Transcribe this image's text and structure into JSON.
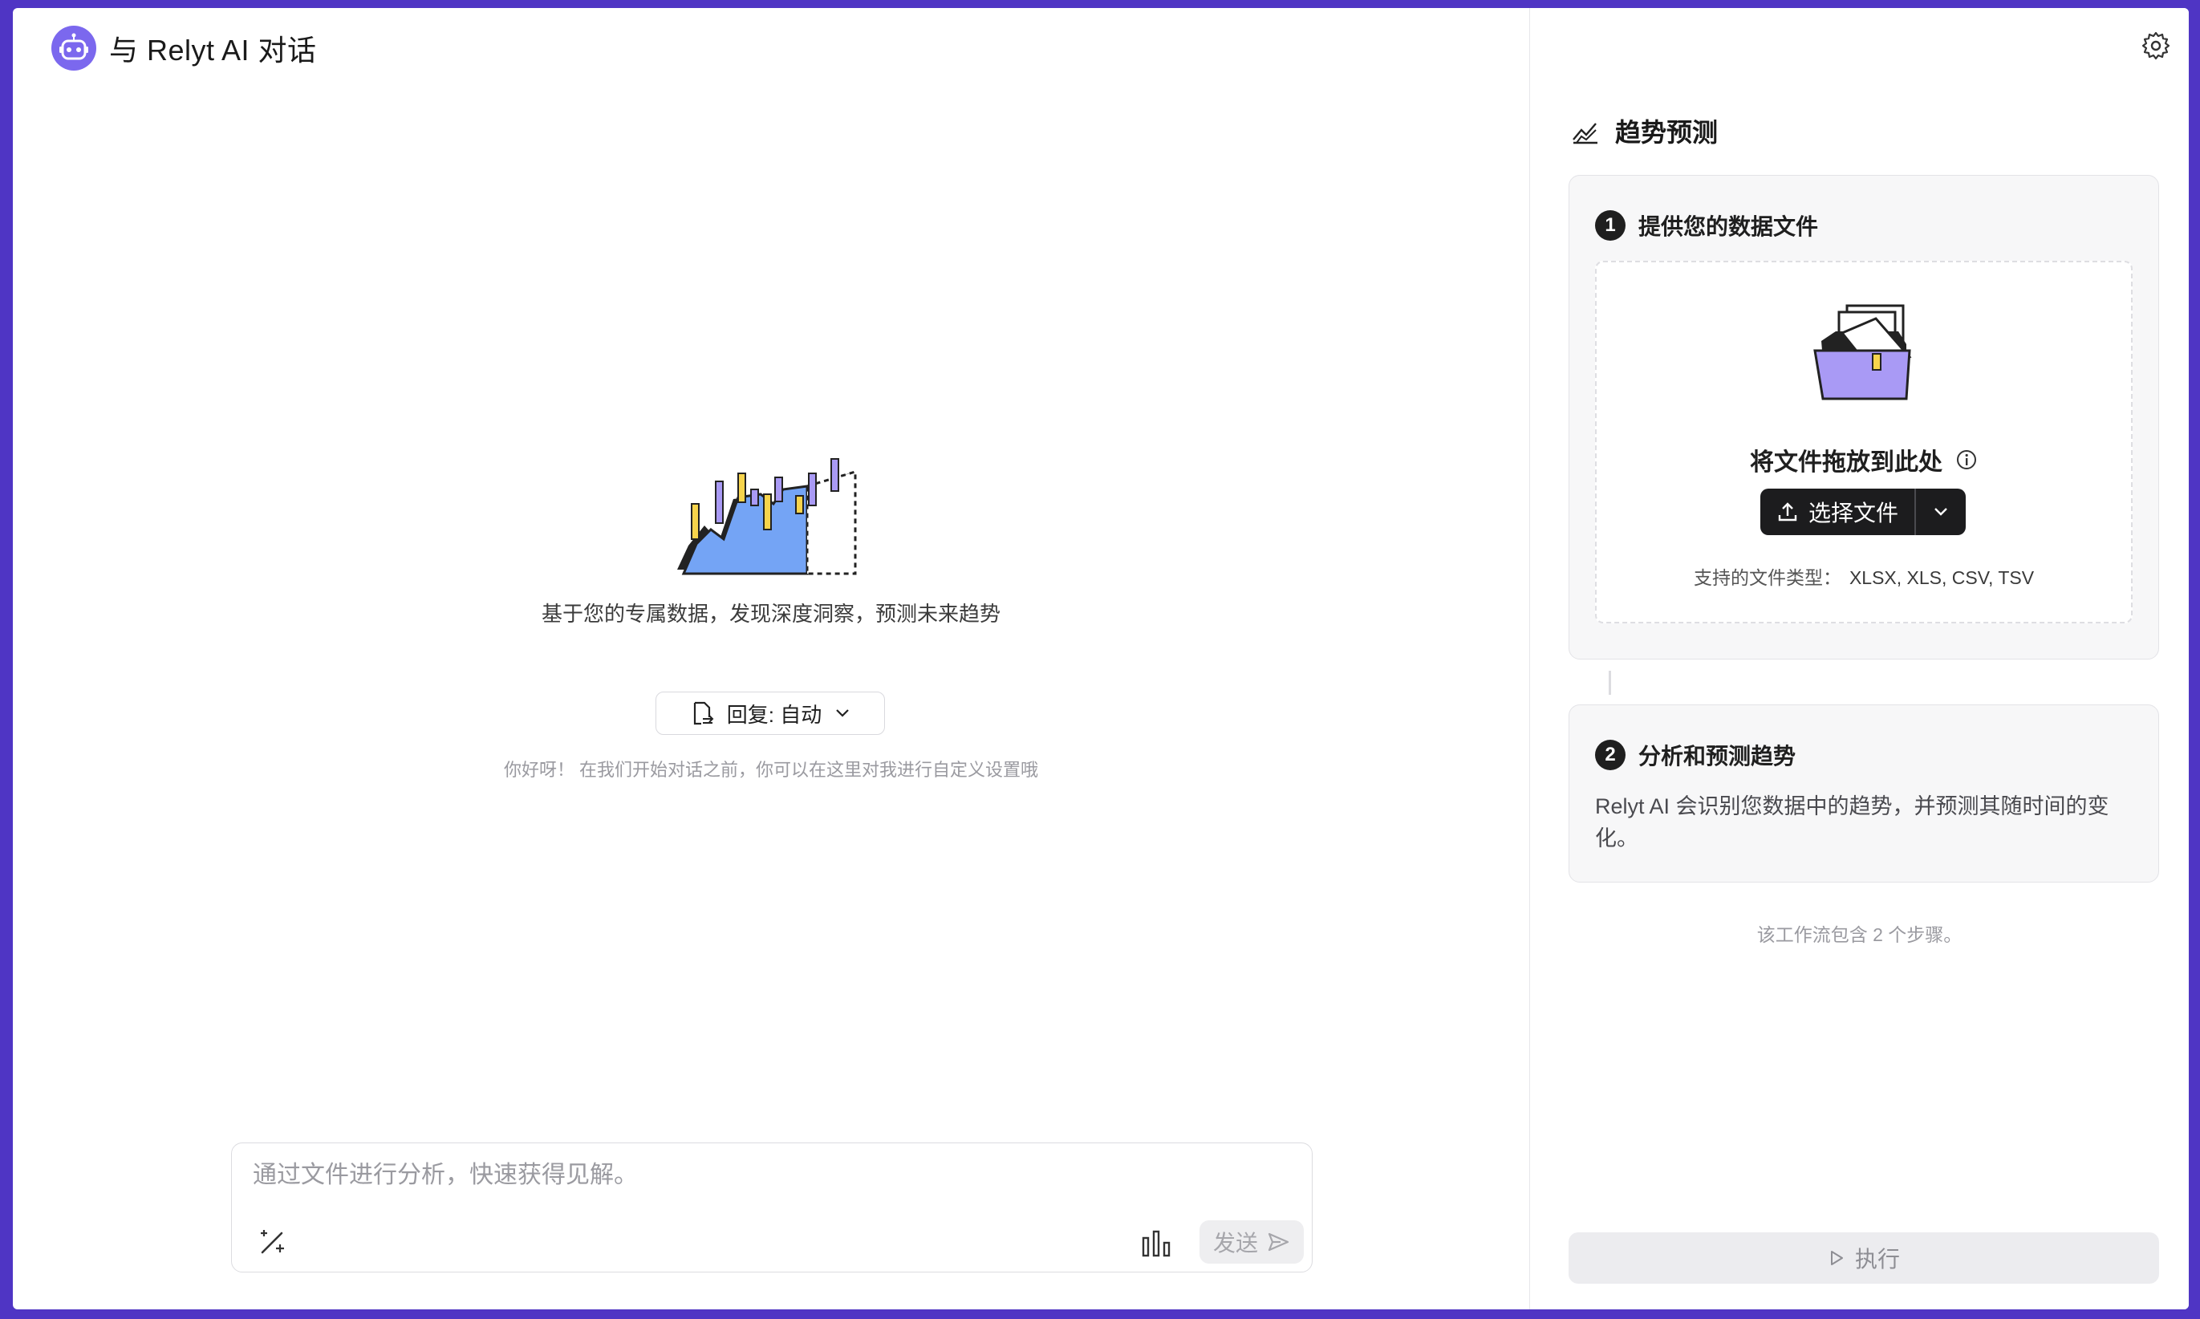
{
  "header": {
    "title": "与 Relyt AI 对话",
    "avatar_icon": "robot-icon"
  },
  "empty_state": {
    "tagline": "基于您的专属数据，发现深度洞察，预测未来趋势",
    "reply_mode_label": "回复: 自动",
    "hint": "你好呀！ 在我们开始对话之前，你可以在这里对我进行自定义设置哦"
  },
  "composer": {
    "placeholder": "通过文件进行分析，快速获得见解。",
    "send_label": "发送"
  },
  "workflow": {
    "title": "趋势预测",
    "steps": [
      {
        "number": "1",
        "title": "提供您的数据文件",
        "drop_title": "将文件拖放到此处",
        "choose_label": "选择文件",
        "formats_label": "支持的文件类型：",
        "formats": "XLSX, XLS, CSV, TSV"
      },
      {
        "number": "2",
        "title": "分析和预测趋势",
        "description": "Relyt AI 会识别您数据中的趋势，并预测其随时间的变化。"
      }
    ],
    "steps_note": "该工作流包含 2 个步骤。",
    "run_label": "执行"
  },
  "colors": {
    "frame": "#4f35c4",
    "accent": "#7b68ee",
    "dark_button": "#1c1c1e"
  }
}
